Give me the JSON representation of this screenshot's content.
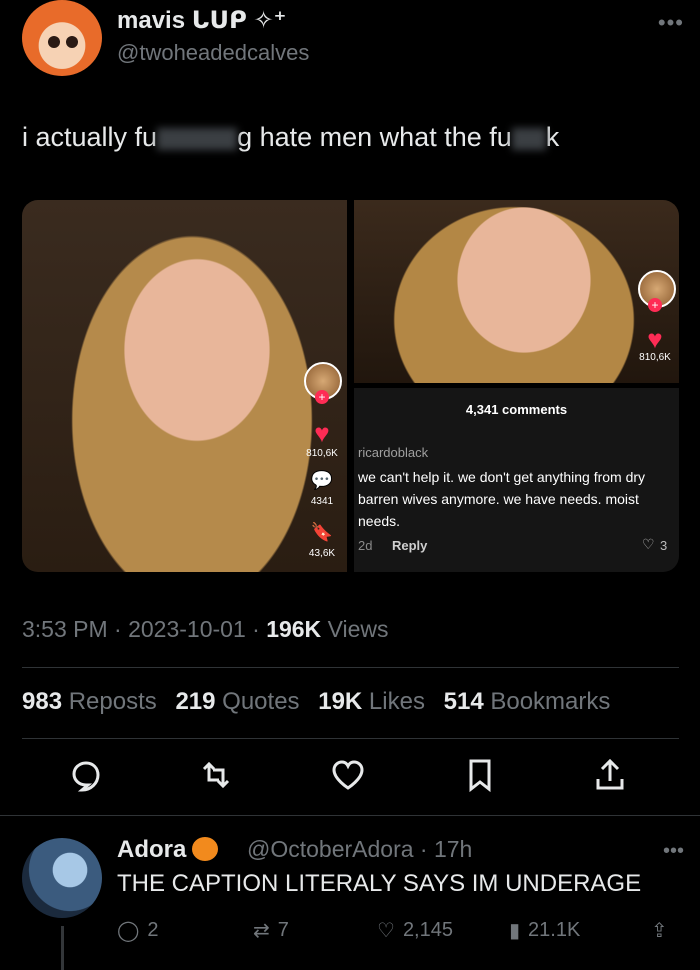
{
  "tweet": {
    "display_name": "mavis ᒐᑌᑭ ✧⁺",
    "handle": "@twoheadedcalves",
    "text_part1": "i actually fu",
    "text_part2": "g hate men what the fu",
    "text_part3": "k",
    "timestamp": "3:53 PM · 2023-10-01 · ",
    "views_count": "196K",
    "views_label": "Views"
  },
  "media": {
    "left": {
      "likes": "810,6K",
      "comments": "4341",
      "saves": "43,6K"
    },
    "right": {
      "likes": "810,6K",
      "comments_header": "4,341 comments",
      "comment_user": "ricardoblack",
      "comment_text": "we can't help it. we don't get anything from dry barren wives anymore. we have needs. moist needs.",
      "comment_age": "2d",
      "comment_reply": "Reply",
      "comment_likes": "3"
    }
  },
  "stats": {
    "reposts_count": "983",
    "reposts_label": "Reposts",
    "quotes_count": "219",
    "quotes_label": "Quotes",
    "likes_count": "19K",
    "likes_label": "Likes",
    "bookmarks_count": "514",
    "bookmarks_label": "Bookmarks"
  },
  "reply": {
    "name": "Adora",
    "handle_time": "@OctoberAdora · 17h",
    "text": "THE CAPTION LITERALY SAYS IM UNDERAGE",
    "replies": "2",
    "reposts": "7",
    "likes": "2,145",
    "views": "21.1K"
  },
  "colors": {
    "background": "#000000",
    "text": "#e7e9ea",
    "muted": "#71767b",
    "tiktok_red": "#fe2c55"
  }
}
